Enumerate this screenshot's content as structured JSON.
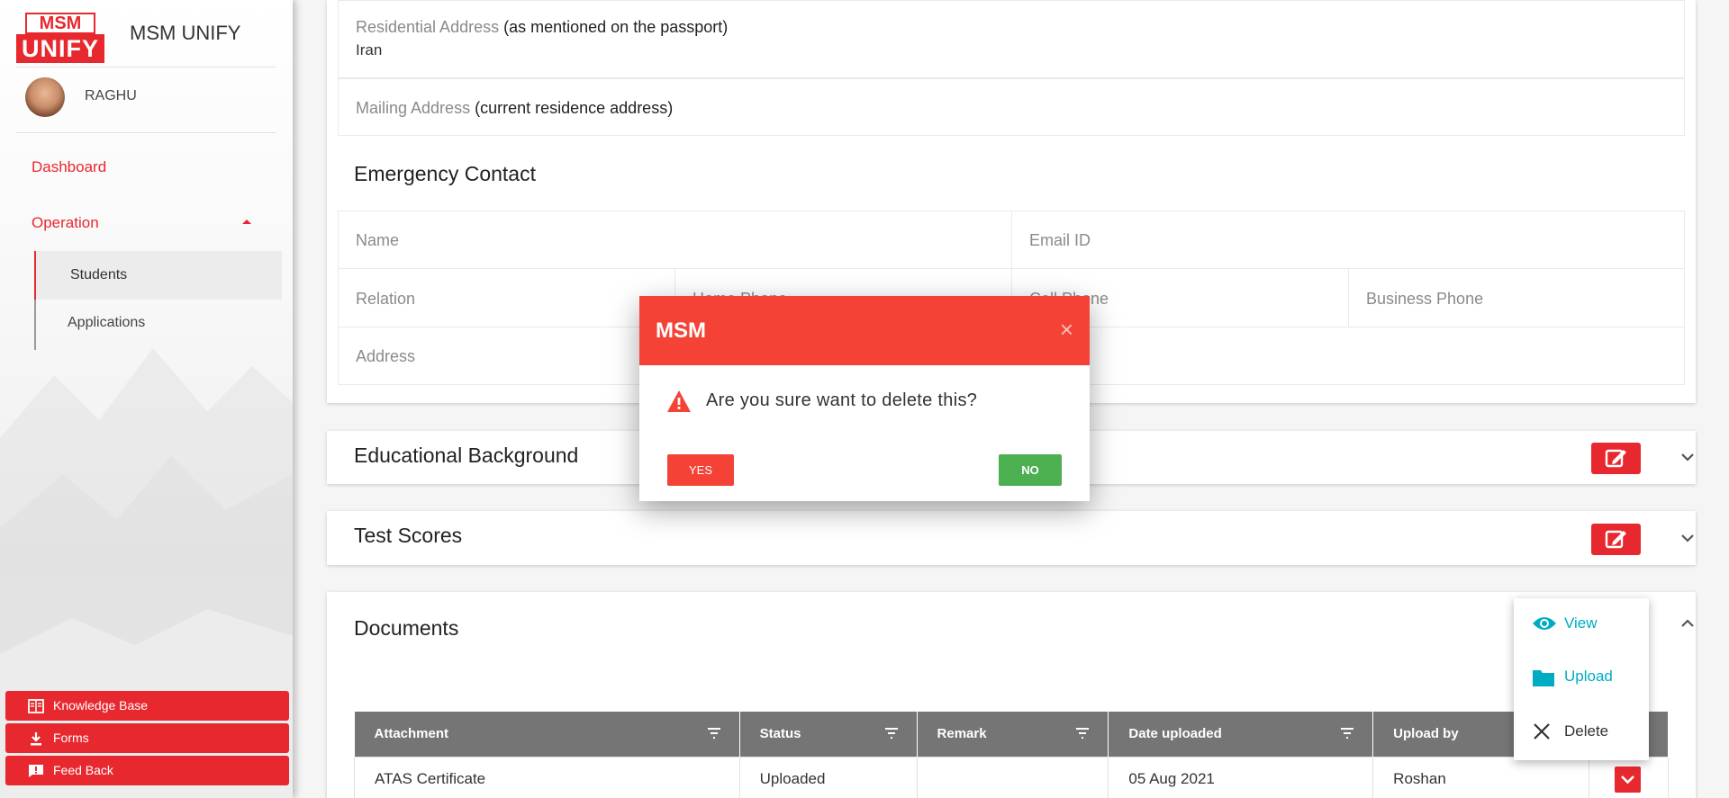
{
  "brand": {
    "logo_top": "MSM",
    "logo_bottom": "UNIFY",
    "app_name": "MSM UNIFY"
  },
  "user": {
    "name": "RAGHU"
  },
  "nav": {
    "dashboard": "Dashboard",
    "operation": "Operation",
    "students": "Students",
    "applications": "Applications"
  },
  "side_buttons": {
    "knowledge_base": "Knowledge Base",
    "forms": "Forms",
    "feedback": "Feed Back"
  },
  "address": {
    "residential_label": "Residential Address",
    "residential_note": "(as mentioned on the passport)",
    "residential_value": "Iran",
    "mailing_label": "Mailing Address",
    "mailing_note": "(current residence address)"
  },
  "emergency": {
    "title": "Emergency Contact",
    "name": "Name",
    "email": "Email ID",
    "relation": "Relation",
    "home_phone": "Home Phone",
    "cell_phone": "Cell Phone",
    "business_phone": "Business Phone",
    "address": "Address"
  },
  "sections": {
    "educational": "Educational Background",
    "test_scores": "Test Scores",
    "documents": "Documents"
  },
  "documents_table": {
    "headers": [
      "Attachment",
      "Status",
      "Remark",
      "Date uploaded",
      "Upload by"
    ],
    "rows": [
      {
        "attachment": "ATAS Certificate",
        "status": "Uploaded",
        "remark": "",
        "date": "05 Aug 2021",
        "by": "Roshan"
      }
    ]
  },
  "context_menu": {
    "view": "View",
    "upload": "Upload",
    "delete": "Delete"
  },
  "modal": {
    "title": "MSM",
    "close": "×",
    "message": "Are you sure want to delete this?",
    "yes": "YES",
    "no": "NO"
  },
  "colors": {
    "brand_red": "#e8282f",
    "modal_red": "#f44336",
    "green": "#4caf50",
    "teal": "#00acc1",
    "table_header": "#757575"
  }
}
